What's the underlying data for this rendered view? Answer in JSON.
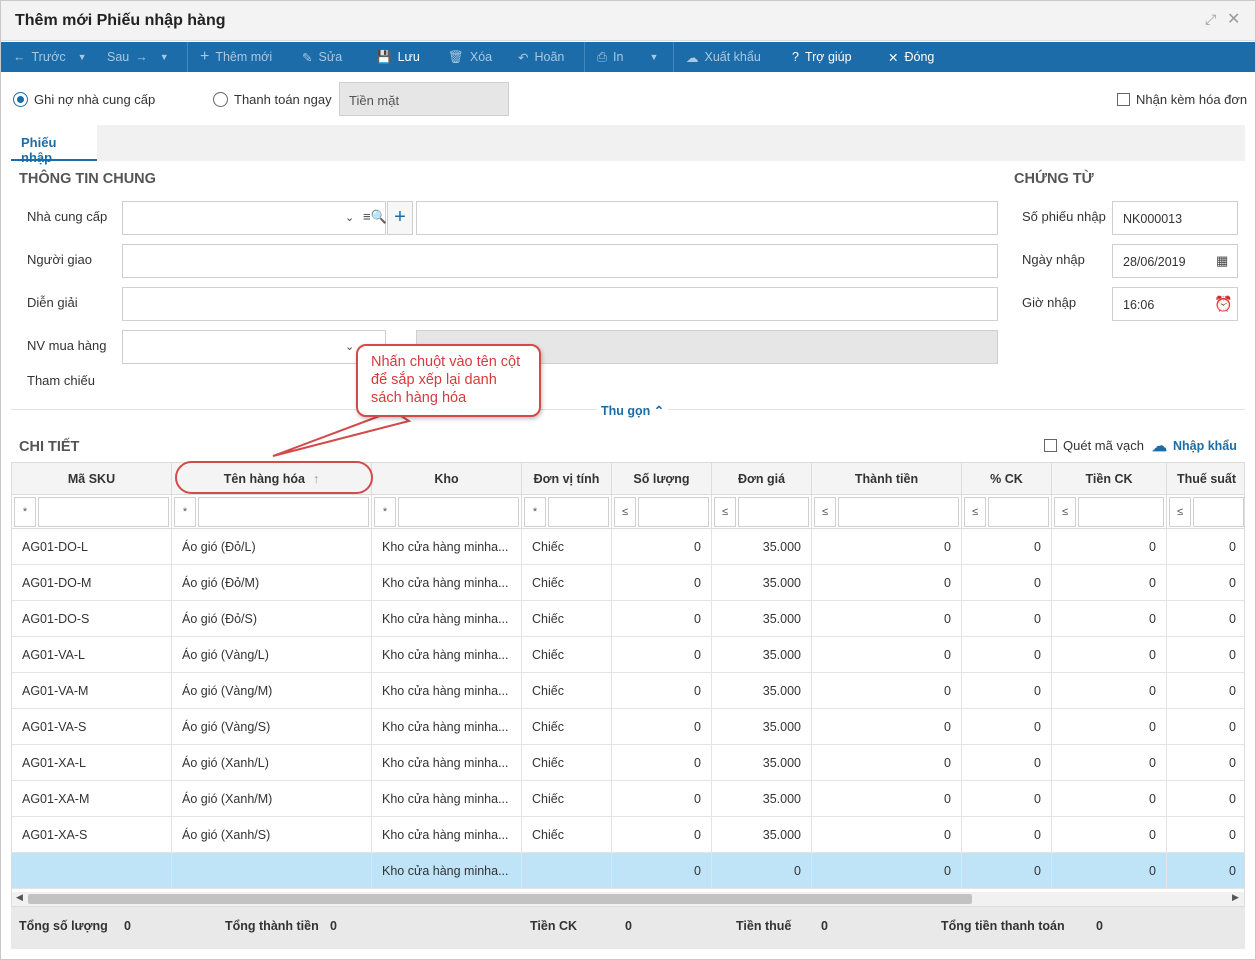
{
  "window": {
    "title": "Thêm mới Phiếu nhập hàng"
  },
  "toolbar": {
    "prev": "Trước",
    "next": "Sau",
    "add": "Thêm mới",
    "edit": "Sửa",
    "save": "Lưu",
    "delete": "Xóa",
    "undo": "Hoãn",
    "print": "In",
    "export": "Xuất khẩu",
    "help": "Trợ giúp",
    "close": "Đóng"
  },
  "payment": {
    "debt_label": "Ghi nợ nhà cung cấp",
    "pay_now_label": "Thanh toán ngay",
    "method_value": "Tiền mặt",
    "invoice_label": "Nhận kèm hóa đơn"
  },
  "tabs": [
    "Phiếu nhập"
  ],
  "general": {
    "title": "THÔNG TIN CHUNG",
    "supplier_label": "Nhà cung cấp",
    "deliverer_label": "Người giao",
    "description_label": "Diễn giải",
    "buyer_label": "NV mua hàng",
    "reference_label": "Tham chiếu",
    "collapse_label": "Thu gọn"
  },
  "voucher": {
    "title": "CHỨNG TỪ",
    "number_label": "Số phiếu nhập",
    "number_value": "NK000013",
    "date_label": "Ngày nhập",
    "date_value": "28/06/2019",
    "time_label": "Giờ nhập",
    "time_value": "16:06"
  },
  "callout": {
    "text": "Nhấn chuột vào tên cột để sắp xếp lại danh sách hàng hóa"
  },
  "detail": {
    "title": "CHI TIẾT",
    "barcode_label": "Quét mã vạch",
    "import_label": "Nhập khẩu",
    "columns": [
      "Mã SKU",
      "Tên hàng hóa",
      "Kho",
      "Đơn vị tính",
      "Số lượng",
      "Đơn giá",
      "Thành tiền",
      "% CK",
      "Tiền CK",
      "Thuế suất"
    ],
    "sort_glyph": "↑",
    "filter_ops": [
      "*",
      "*",
      "*",
      "*",
      "≤",
      "≤",
      "≤",
      "≤",
      "≤",
      "≤"
    ],
    "rows": [
      [
        "AG01-DO-L",
        "Áo gió (Đỏ/L)",
        "Kho cửa hàng minha...",
        "Chiếc",
        "0",
        "35.000",
        "0",
        "0",
        "0",
        "0"
      ],
      [
        "AG01-DO-M",
        "Áo gió (Đỏ/M)",
        "Kho cửa hàng minha...",
        "Chiếc",
        "0",
        "35.000",
        "0",
        "0",
        "0",
        "0"
      ],
      [
        "AG01-DO-S",
        "Áo gió (Đỏ/S)",
        "Kho cửa hàng minha...",
        "Chiếc",
        "0",
        "35.000",
        "0",
        "0",
        "0",
        "0"
      ],
      [
        "AG01-VA-L",
        "Áo gió (Vàng/L)",
        "Kho cửa hàng minha...",
        "Chiếc",
        "0",
        "35.000",
        "0",
        "0",
        "0",
        "0"
      ],
      [
        "AG01-VA-M",
        "Áo gió (Vàng/M)",
        "Kho cửa hàng minha...",
        "Chiếc",
        "0",
        "35.000",
        "0",
        "0",
        "0",
        "0"
      ],
      [
        "AG01-VA-S",
        "Áo gió (Vàng/S)",
        "Kho cửa hàng minha...",
        "Chiếc",
        "0",
        "35.000",
        "0",
        "0",
        "0",
        "0"
      ],
      [
        "AG01-XA-L",
        "Áo gió (Xanh/L)",
        "Kho cửa hàng minha...",
        "Chiếc",
        "0",
        "35.000",
        "0",
        "0",
        "0",
        "0"
      ],
      [
        "AG01-XA-M",
        "Áo gió (Xanh/M)",
        "Kho cửa hàng minha...",
        "Chiếc",
        "0",
        "35.000",
        "0",
        "0",
        "0",
        "0"
      ],
      [
        "AG01-XA-S",
        "Áo gió (Xanh/S)",
        "Kho cửa hàng minha...",
        "Chiếc",
        "0",
        "35.000",
        "0",
        "0",
        "0",
        "0"
      ],
      [
        "",
        "",
        "Kho cửa hàng minha...",
        "",
        "0",
        "0",
        "0",
        "0",
        "0",
        "0"
      ]
    ]
  },
  "totals": {
    "qty_label": "Tổng số lượng",
    "qty_value": "0",
    "amount_label": "Tổng thành tiền",
    "amount_value": "0",
    "discount_label": "Tiền CK",
    "discount_value": "0",
    "tax_label": "Tiền thuế",
    "tax_value": "0",
    "payment_label": "Tổng tiền thanh toán",
    "payment_value": "0"
  },
  "colors": {
    "primary": "#1b6ca8",
    "callout": "#d24a4a",
    "selected_row": "#bfe3f7"
  }
}
